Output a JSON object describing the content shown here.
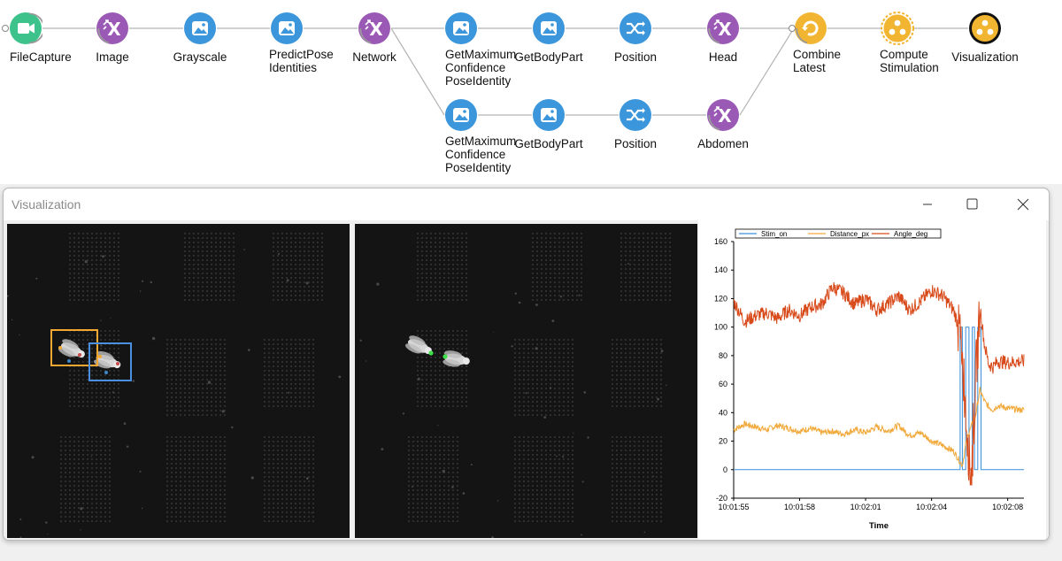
{
  "graph": {
    "nodes": [
      {
        "id": "filecapture",
        "label": "FileCapture",
        "kind": "source",
        "color": "#3cc28a",
        "icon": "video-camera-icon"
      },
      {
        "id": "image",
        "label": "Image",
        "kind": "transform",
        "color": "#9b59b6",
        "icon": "transform-x-icon"
      },
      {
        "id": "grayscale",
        "label": "Grayscale",
        "kind": "combinator",
        "color": "#3b96db",
        "icon": "image-icon"
      },
      {
        "id": "predictpose",
        "label": "PredictPose\nIdentities",
        "kind": "combinator",
        "color": "#3b96db",
        "icon": "image-icon"
      },
      {
        "id": "network",
        "label": "Network",
        "kind": "transform",
        "color": "#9b59b6",
        "icon": "transform-x-icon"
      },
      {
        "id": "getmax1",
        "label": "GetMaximum\nConfidence\nPoseIdentity",
        "kind": "combinator",
        "color": "#3b96db",
        "icon": "image-icon"
      },
      {
        "id": "getbody1",
        "label": "GetBodyPart",
        "kind": "combinator",
        "color": "#3b96db",
        "icon": "image-icon"
      },
      {
        "id": "position1",
        "label": "Position",
        "kind": "combinator",
        "color": "#3b96db",
        "icon": "shuffle-icon"
      },
      {
        "id": "head",
        "label": "Head",
        "kind": "transform",
        "color": "#9b59b6",
        "icon": "transform-x-icon"
      },
      {
        "id": "combinelatest",
        "label": "Combine\nLatest",
        "kind": "sink",
        "color": "#f2b531",
        "icon": "refresh-icon"
      },
      {
        "id": "computestim",
        "label": "Compute\nStimulation",
        "kind": "nested",
        "color": "#f2b531",
        "icon": "workflow-icon"
      },
      {
        "id": "visualization",
        "label": "Visualization",
        "kind": "output",
        "color": "#f2b531",
        "icon": "workflow-icon"
      },
      {
        "id": "getmax2",
        "label": "GetMaximum\nConfidence\nPoseIdentity",
        "kind": "combinator",
        "color": "#3b96db",
        "icon": "image-icon"
      },
      {
        "id": "getbody2",
        "label": "GetBodyPart",
        "kind": "combinator",
        "color": "#3b96db",
        "icon": "image-icon"
      },
      {
        "id": "position2",
        "label": "Position",
        "kind": "combinator",
        "color": "#3b96db",
        "icon": "shuffle-icon"
      },
      {
        "id": "abdomen",
        "label": "Abdomen",
        "kind": "transform",
        "color": "#9b59b6",
        "icon": "transform-x-icon"
      }
    ],
    "edges": [
      [
        "filecapture",
        "image"
      ],
      [
        "image",
        "grayscale"
      ],
      [
        "grayscale",
        "predictpose"
      ],
      [
        "predictpose",
        "network"
      ],
      [
        "network",
        "getmax1"
      ],
      [
        "getmax1",
        "getbody1"
      ],
      [
        "getbody1",
        "position1"
      ],
      [
        "position1",
        "head"
      ],
      [
        "head",
        "combinelatest"
      ],
      [
        "combinelatest",
        "computestim"
      ],
      [
        "computestim",
        "visualization"
      ],
      [
        "network",
        "getmax2"
      ],
      [
        "getmax2",
        "getbody2"
      ],
      [
        "getbody2",
        "position2"
      ],
      [
        "position2",
        "abdomen"
      ],
      [
        "abdomen",
        "combinelatest"
      ]
    ]
  },
  "window": {
    "title": "Visualization",
    "minimize_icon": "minimize-icon",
    "maximize_icon": "maximize-icon",
    "close_icon": "close-icon"
  },
  "video_left": {
    "boxes": [
      {
        "id": "fly-1",
        "color": "#f5a733"
      },
      {
        "id": "fly-2",
        "color": "#4a8fe0"
      }
    ]
  },
  "video_right": {
    "markers_color": "#3ee04a"
  },
  "chart_data": {
    "type": "line",
    "xlabel": "Time",
    "ylabel": "",
    "ylim": [
      -20,
      160
    ],
    "yticks": [
      "-20",
      "0",
      "20",
      "40",
      "60",
      "80",
      "100",
      "120",
      "140",
      "160"
    ],
    "xticks": [
      "10:01:55",
      "10:01:58",
      "10:02:01",
      "10:02:04",
      "10:02:08"
    ],
    "legend_position": "top",
    "series": [
      {
        "name": "Stim_on",
        "color": "#3a8fd9",
        "x_seconds": [
          0,
          10.3,
          10.3,
          10.4,
          10.4,
          10.55,
          10.55,
          10.7,
          10.7,
          10.85,
          10.85,
          10.95,
          10.95,
          11.1,
          11.1,
          11.25,
          11.25,
          11.4,
          11.4,
          13.2
        ],
        "values": [
          0,
          0,
          100,
          100,
          0,
          0,
          100,
          100,
          0,
          0,
          100,
          100,
          0,
          0,
          100,
          100,
          0,
          0,
          0,
          0
        ]
      },
      {
        "name": "Distance_px",
        "color": "#f0a93a",
        "x_seconds": [
          0,
          0.5,
          1,
          1.5,
          2,
          2.5,
          3,
          3.5,
          4,
          4.5,
          5,
          5.5,
          6,
          6.5,
          7,
          7.5,
          8,
          8.5,
          9,
          9.5,
          10,
          10.2,
          10.4,
          10.6,
          10.8,
          11,
          11.2,
          11.4,
          11.6,
          11.8,
          12,
          12.5,
          13,
          13.2
        ],
        "values": [
          28,
          32,
          30,
          28,
          31,
          29,
          27,
          29,
          26,
          27,
          25,
          28,
          26,
          30,
          27,
          31,
          24,
          26,
          20,
          17,
          13,
          8,
          3,
          22,
          30,
          38,
          56,
          48,
          44,
          42,
          45,
          43,
          42,
          42
        ]
      },
      {
        "name": "Angle_deg",
        "color": "#d84a1a",
        "x_seconds": [
          0,
          0.5,
          1,
          1.5,
          2,
          2.5,
          3,
          3.5,
          4,
          4.5,
          5,
          5.5,
          6,
          6.5,
          7,
          7.5,
          8,
          8.5,
          9,
          9.5,
          10,
          10.2,
          10.4,
          10.6,
          10.8,
          11,
          11.2,
          11.4,
          11.6,
          11.8,
          12,
          12.5,
          13,
          13.2
        ],
        "values": [
          118,
          104,
          108,
          110,
          106,
          112,
          108,
          114,
          116,
          128,
          124,
          116,
          120,
          112,
          116,
          122,
          112,
          118,
          126,
          122,
          112,
          102,
          80,
          30,
          -5,
          60,
          116,
          88,
          74,
          72,
          76,
          75,
          76,
          76
        ]
      }
    ]
  }
}
